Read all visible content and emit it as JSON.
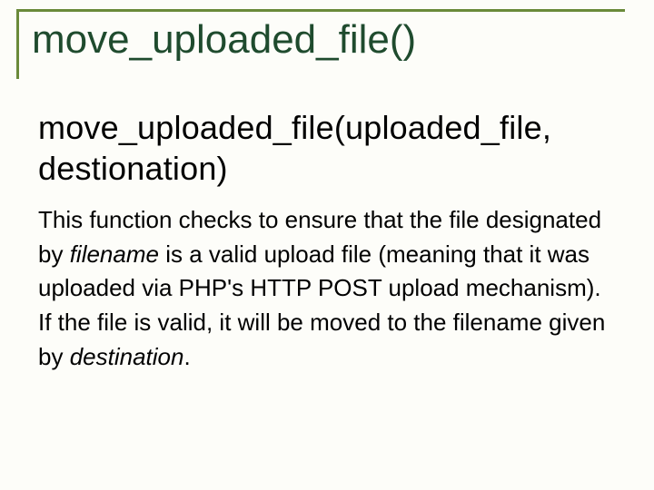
{
  "title": "move_uploaded_file()",
  "signature": "move_uploaded_file(uploaded_file, destionation)",
  "description_parts": {
    "p1": "This function checks to ensure that the file designated by ",
    "em1": "filename",
    "p2": " is a valid upload file (meaning that it was uploaded via PHP's HTTP POST upload mechanism). If the file is valid, it will be moved to the filename given by ",
    "em2": "destination",
    "p3": "."
  }
}
